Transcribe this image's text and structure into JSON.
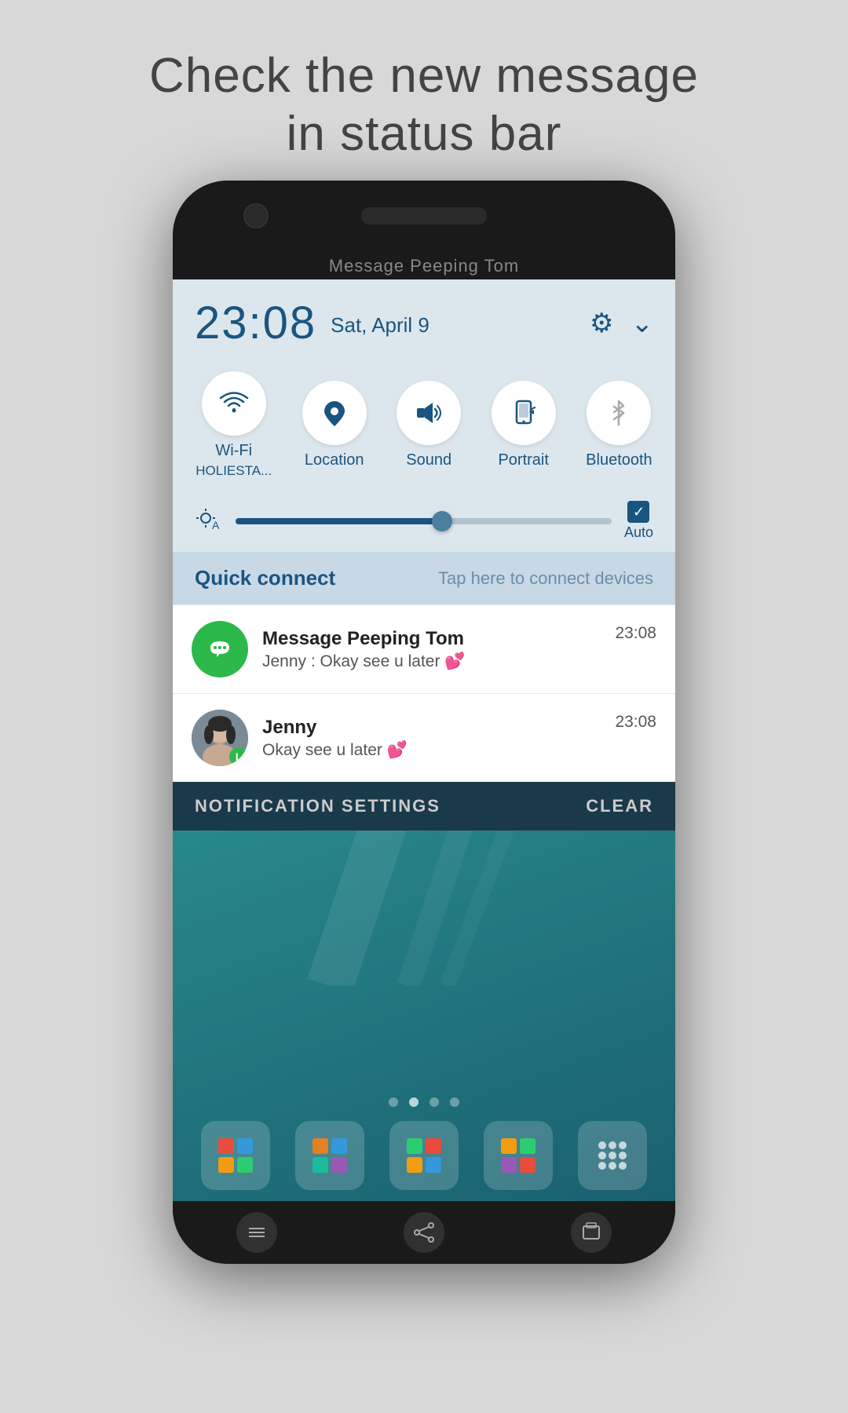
{
  "page": {
    "heading_line1": "Check the new message",
    "heading_line2": "in status bar"
  },
  "phone": {
    "name_label": "Message Peeping Tom"
  },
  "status_bar": {
    "time": "23:08",
    "date": "Sat, April 9"
  },
  "quick_toggles": [
    {
      "id": "wifi",
      "label": "Wi-Fi",
      "sublabel": "HOLIESTA...",
      "active": true
    },
    {
      "id": "location",
      "label": "Location",
      "sublabel": "",
      "active": true
    },
    {
      "id": "sound",
      "label": "Sound",
      "sublabel": "",
      "active": true
    },
    {
      "id": "portrait",
      "label": "Portrait",
      "sublabel": "",
      "active": true
    },
    {
      "id": "bluetooth",
      "label": "Bluetooth",
      "sublabel": "",
      "active": false
    }
  ],
  "brightness": {
    "auto_label": "Auto",
    "fill_percent": 55
  },
  "quick_connect": {
    "label": "Quick connect",
    "hint": "Tap here to connect devices"
  },
  "notifications": [
    {
      "app": "Message Peeping Tom",
      "message": "Jenny : Okay  see u later 💕",
      "time": "23:08",
      "icon_type": "app"
    },
    {
      "app": "Jenny",
      "message": "Okay  see u later 💕",
      "time": "23:08",
      "icon_type": "avatar"
    }
  ],
  "actions": {
    "settings_label": "NOTIFICATION SETTINGS",
    "clear_label": "CLEAR"
  },
  "bottom_nav": {
    "menu_icon": "☰",
    "home_icon": "⌂",
    "square_icon": "⬜"
  }
}
